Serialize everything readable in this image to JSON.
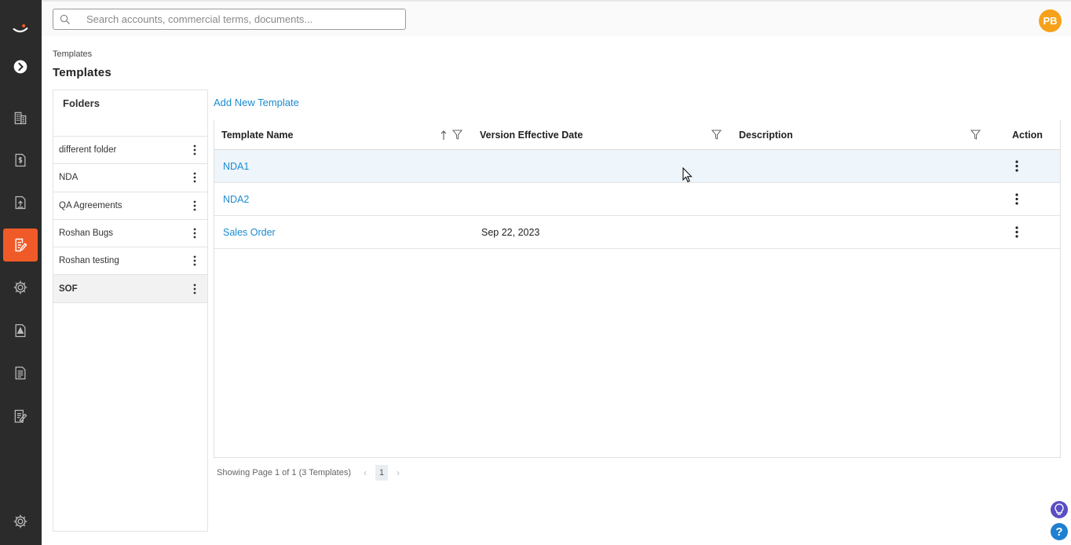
{
  "topbar": {
    "search_placeholder": "Search accounts, commercial terms, documents...",
    "avatar_initials": "PB"
  },
  "sidebar": {
    "items": [
      {
        "icon": "logo-icon"
      },
      {
        "icon": "expand-chevron-icon"
      },
      {
        "icon": "buildings-icon"
      },
      {
        "icon": "document-dollar-icon"
      },
      {
        "icon": "document-upload-icon"
      },
      {
        "icon": "templates-edit-icon",
        "active": true
      },
      {
        "icon": "gear-icon"
      },
      {
        "icon": "document-alert-icon"
      },
      {
        "icon": "report-icon"
      },
      {
        "icon": "sign-document-icon"
      },
      {
        "icon": "settings-gear-icon"
      }
    ],
    "active_color": "#f05a28"
  },
  "breadcrumb": "Templates",
  "page_title": "Templates",
  "folders": {
    "title": "Folders",
    "items": [
      {
        "label": "different folder"
      },
      {
        "label": "NDA"
      },
      {
        "label": "QA Agreements"
      },
      {
        "label": "Roshan Bugs"
      },
      {
        "label": "Roshan testing"
      },
      {
        "label": "SOF",
        "selected": true
      }
    ]
  },
  "main": {
    "add_new_label": "Add New Template",
    "columns": [
      "Template Name",
      "Version Effective Date",
      "Description",
      "Action"
    ],
    "rows": [
      {
        "name": "NDA1",
        "date": "",
        "description": ""
      },
      {
        "name": "NDA2",
        "date": "",
        "description": ""
      },
      {
        "name": "Sales Order",
        "date": "Sep 22, 2023",
        "description": ""
      }
    ],
    "pager": {
      "summary": "Showing Page 1 of 1 (3 Templates)",
      "current_page": "1",
      "prev": "‹",
      "next": "›"
    }
  },
  "help": {
    "question": "?"
  },
  "colors": {
    "link": "#1a8bd1",
    "avatar": "#f7a11a",
    "sidebar_bg": "#2b2b2b"
  }
}
